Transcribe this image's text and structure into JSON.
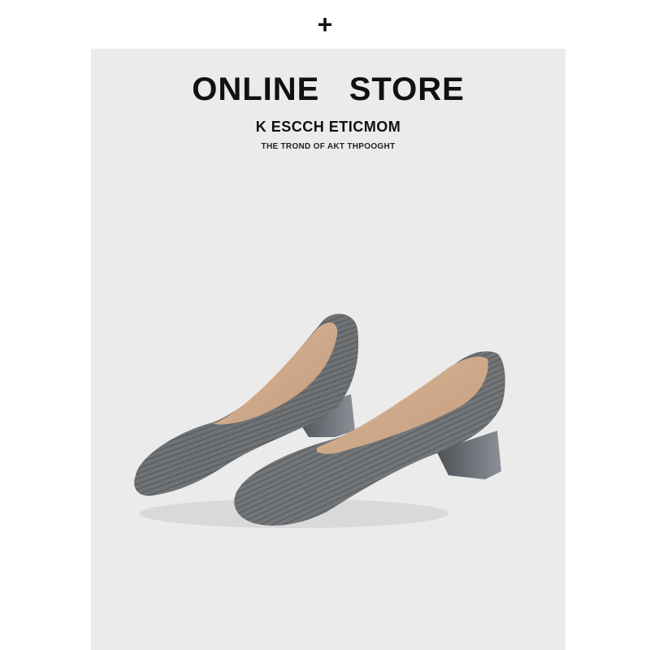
{
  "top_icon": {
    "glyph": "+",
    "name": "plus-icon"
  },
  "banner": {
    "title": "ONLINE   STORE",
    "subtitle": "K ESCCH ETICMOM",
    "tagline": "THE TROND OF AKT THPOOGHT"
  },
  "product": {
    "description_icon": "shoes-icon",
    "colors": {
      "knit": "#6f7275",
      "knit_dark": "#55585b",
      "lining": "#cfa98a",
      "heel": "#7d8288",
      "background": "#ebebeb"
    }
  }
}
